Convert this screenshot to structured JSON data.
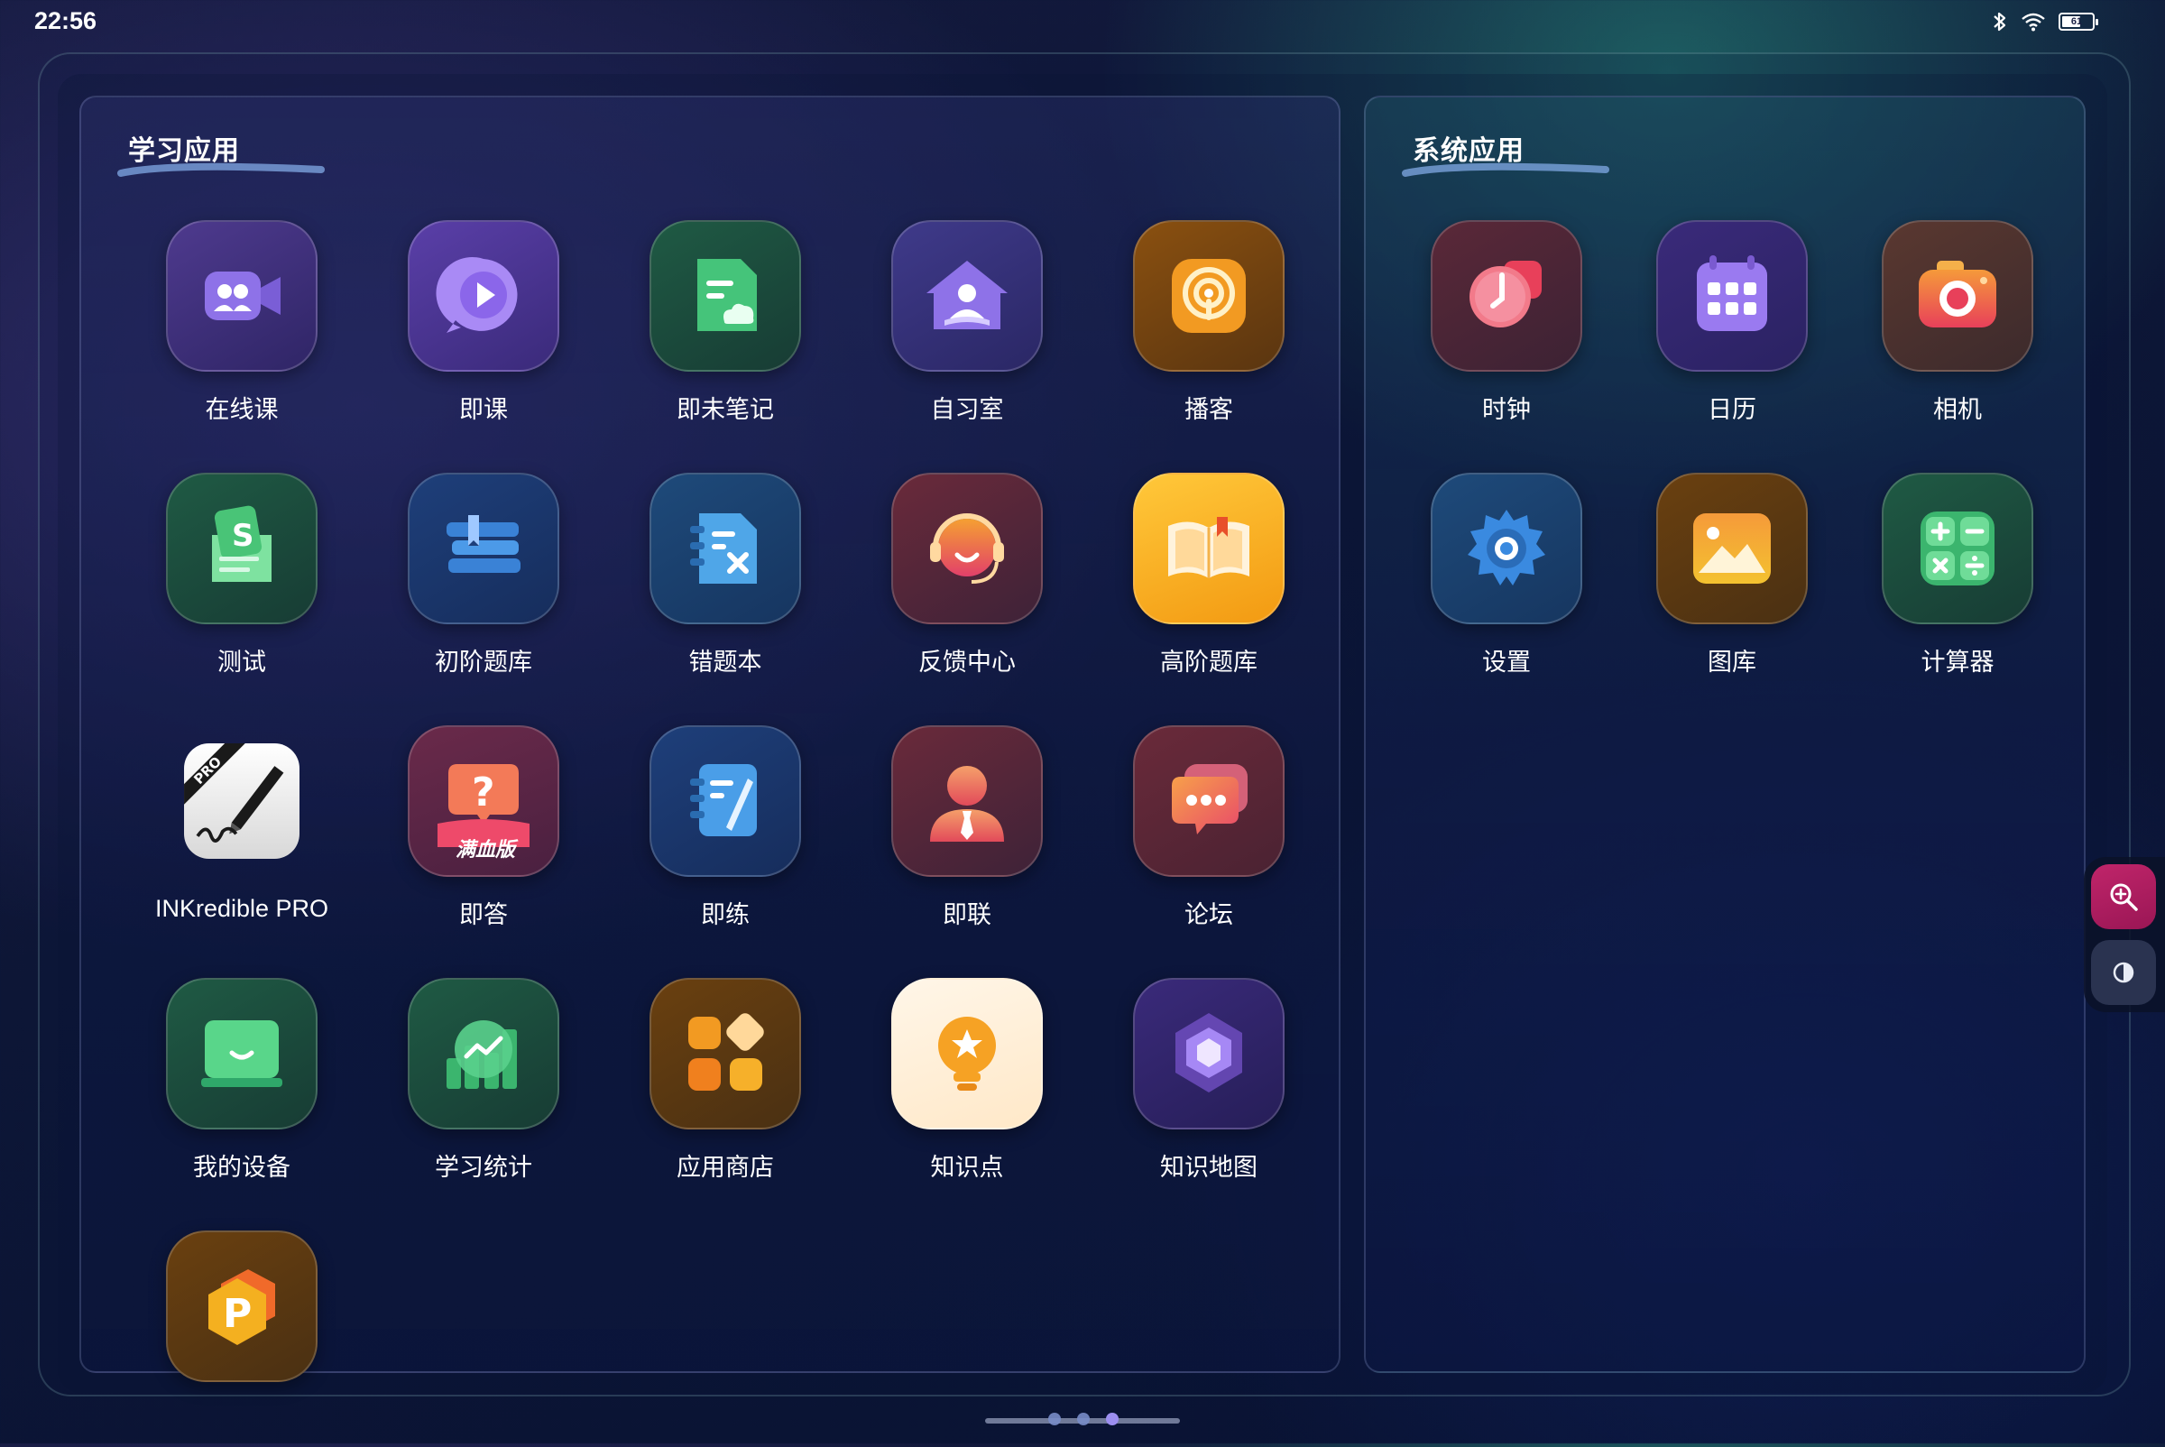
{
  "status_bar": {
    "time": "22:56",
    "battery_level": "61",
    "icons": [
      "bluetooth-icon",
      "wifi-icon",
      "battery-icon"
    ]
  },
  "learning_panel": {
    "title": "学习应用",
    "apps": [
      {
        "label": "在线课",
        "icon": "video-class-icon",
        "color": "#6b4fb8"
      },
      {
        "label": "即课",
        "icon": "play-bubble-icon",
        "color": "#7b5ad0"
      },
      {
        "label": "即未笔记",
        "icon": "note-icon",
        "color": "#2e9c62"
      },
      {
        "label": "自习室",
        "icon": "study-room-icon",
        "color": "#6a4ec0"
      },
      {
        "label": "播客",
        "icon": "podcast-icon",
        "color": "#e08a1e"
      },
      {
        "label": "测试",
        "icon": "test-icon",
        "color": "#3aa060"
      },
      {
        "label": "初阶题库",
        "icon": "books-icon",
        "color": "#2c6db8"
      },
      {
        "label": "错题本",
        "icon": "error-book-icon",
        "color": "#2f7ab8"
      },
      {
        "label": "反馈中心",
        "icon": "headset-icon",
        "color": "#c0562e"
      },
      {
        "label": "高阶题库",
        "icon": "open-book-icon",
        "color": "#f2a21a"
      },
      {
        "label": "INKredible PRO",
        "icon": "pen-icon",
        "color": "#f4f4f4"
      },
      {
        "label": "即答",
        "icon": "question-bubble-icon",
        "color": "#d04a64"
      },
      {
        "label": "即练",
        "icon": "practice-icon",
        "color": "#2c72c0"
      },
      {
        "label": "即联",
        "icon": "person-tie-icon",
        "color": "#c24a3c"
      },
      {
        "label": "论坛",
        "icon": "chat-icon",
        "color": "#d55a40"
      },
      {
        "label": "我的设备",
        "icon": "device-icon",
        "color": "#2fa86a"
      },
      {
        "label": "学习统计",
        "icon": "stats-icon",
        "color": "#2c9a60"
      },
      {
        "label": "应用商店",
        "icon": "app-store-icon",
        "color": "#e2861e"
      },
      {
        "label": "知识点",
        "icon": "lightbulb-icon",
        "color": "#f6a224"
      },
      {
        "label": "知识地图",
        "icon": "hexagon-map-icon",
        "color": "#7a55d0"
      },
      {
        "label": "",
        "icon": "p-hexagon-icon",
        "color": "#f0a020"
      }
    ],
    "badge_text": "满血版",
    "pro_text": "PRO"
  },
  "system_panel": {
    "title": "系统应用",
    "apps": [
      {
        "label": "时钟",
        "icon": "clock-icon",
        "color": "#d84a5c"
      },
      {
        "label": "日历",
        "icon": "calendar-icon",
        "color": "#7a5ad0"
      },
      {
        "label": "相机",
        "icon": "camera-icon",
        "color": "#e85a4a"
      },
      {
        "label": "设置",
        "icon": "gear-icon",
        "color": "#2f7ac8"
      },
      {
        "label": "图库",
        "icon": "gallery-icon",
        "color": "#ee8a2a"
      },
      {
        "label": "计算器",
        "icon": "calculator-icon",
        "color": "#2e9c62"
      }
    ]
  },
  "side_tools": {
    "zoom_icon": "zoom-in-icon",
    "contrast_icon": "contrast-icon",
    "accent": "#c0256a"
  },
  "pager": {
    "pages": 3,
    "current": 3
  }
}
